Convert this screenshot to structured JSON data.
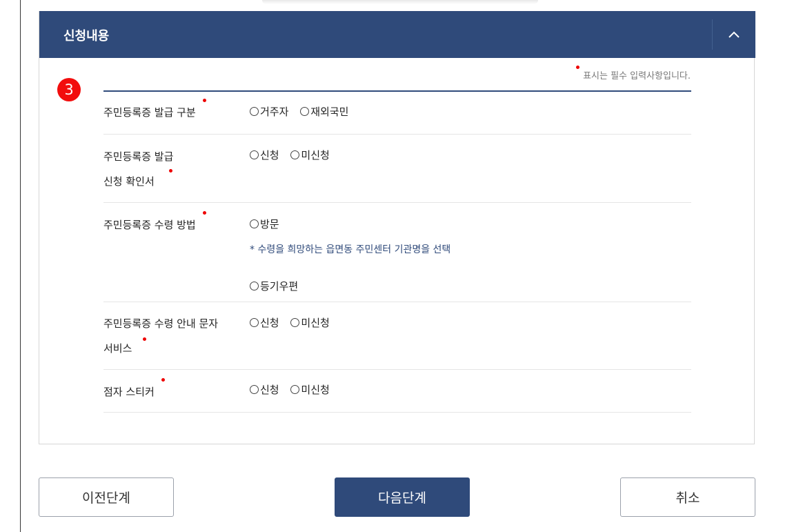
{
  "section": {
    "title": "신청내용",
    "step_number": "3",
    "required_note": "표시는 필수 입력사항입니다."
  },
  "form": {
    "issue_type": {
      "label": "주민등록증 발급 구분",
      "options": [
        "거주자",
        "재외국민"
      ]
    },
    "confirmation": {
      "label_line1": "주민등록증 발급",
      "label_line2": "신청 확인서",
      "options": [
        "신청",
        "미신청"
      ]
    },
    "receive_method": {
      "label": "주민등록증 수령 방법",
      "option_visit": "방문",
      "hint": "* 수령을 희망하는 읍면동 주민센터 기관명을 선택",
      "option_mail": "등기우편"
    },
    "sms_service": {
      "label_line1": "주민등록증 수령 안내 문자",
      "label_line2": "서비스",
      "options": [
        "신청",
        "미신청"
      ]
    },
    "braille_sticker": {
      "label": "점자 스티커",
      "options": [
        "신청",
        "미신청"
      ]
    }
  },
  "buttons": {
    "prev": "이전단계",
    "next": "다음단계",
    "cancel": "취소"
  },
  "icons": {
    "collapse": "chevron-up-icon",
    "radio": "radio-circle-icon"
  },
  "colors": {
    "header": "#2f4a7a",
    "required": "#e00000",
    "badge": "#f20d0d"
  }
}
